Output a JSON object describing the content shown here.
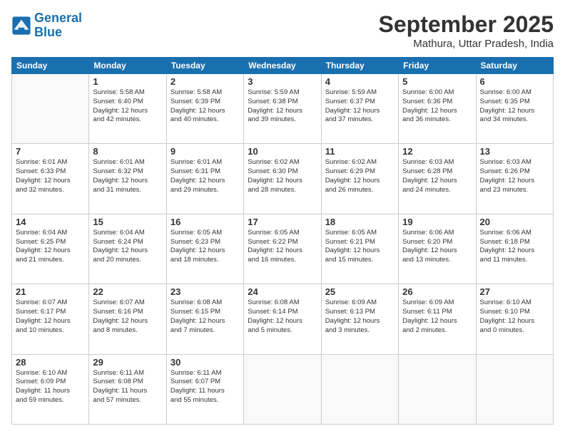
{
  "header": {
    "logo_line1": "General",
    "logo_line2": "Blue",
    "month": "September 2025",
    "location": "Mathura, Uttar Pradesh, India"
  },
  "weekdays": [
    "Sunday",
    "Monday",
    "Tuesday",
    "Wednesday",
    "Thursday",
    "Friday",
    "Saturday"
  ],
  "weeks": [
    [
      {
        "day": "",
        "info": ""
      },
      {
        "day": "1",
        "info": "Sunrise: 5:58 AM\nSunset: 6:40 PM\nDaylight: 12 hours\nand 42 minutes."
      },
      {
        "day": "2",
        "info": "Sunrise: 5:58 AM\nSunset: 6:39 PM\nDaylight: 12 hours\nand 40 minutes."
      },
      {
        "day": "3",
        "info": "Sunrise: 5:59 AM\nSunset: 6:38 PM\nDaylight: 12 hours\nand 39 minutes."
      },
      {
        "day": "4",
        "info": "Sunrise: 5:59 AM\nSunset: 6:37 PM\nDaylight: 12 hours\nand 37 minutes."
      },
      {
        "day": "5",
        "info": "Sunrise: 6:00 AM\nSunset: 6:36 PM\nDaylight: 12 hours\nand 36 minutes."
      },
      {
        "day": "6",
        "info": "Sunrise: 6:00 AM\nSunset: 6:35 PM\nDaylight: 12 hours\nand 34 minutes."
      }
    ],
    [
      {
        "day": "7",
        "info": "Sunrise: 6:01 AM\nSunset: 6:33 PM\nDaylight: 12 hours\nand 32 minutes."
      },
      {
        "day": "8",
        "info": "Sunrise: 6:01 AM\nSunset: 6:32 PM\nDaylight: 12 hours\nand 31 minutes."
      },
      {
        "day": "9",
        "info": "Sunrise: 6:01 AM\nSunset: 6:31 PM\nDaylight: 12 hours\nand 29 minutes."
      },
      {
        "day": "10",
        "info": "Sunrise: 6:02 AM\nSunset: 6:30 PM\nDaylight: 12 hours\nand 28 minutes."
      },
      {
        "day": "11",
        "info": "Sunrise: 6:02 AM\nSunset: 6:29 PM\nDaylight: 12 hours\nand 26 minutes."
      },
      {
        "day": "12",
        "info": "Sunrise: 6:03 AM\nSunset: 6:28 PM\nDaylight: 12 hours\nand 24 minutes."
      },
      {
        "day": "13",
        "info": "Sunrise: 6:03 AM\nSunset: 6:26 PM\nDaylight: 12 hours\nand 23 minutes."
      }
    ],
    [
      {
        "day": "14",
        "info": "Sunrise: 6:04 AM\nSunset: 6:25 PM\nDaylight: 12 hours\nand 21 minutes."
      },
      {
        "day": "15",
        "info": "Sunrise: 6:04 AM\nSunset: 6:24 PM\nDaylight: 12 hours\nand 20 minutes."
      },
      {
        "day": "16",
        "info": "Sunrise: 6:05 AM\nSunset: 6:23 PM\nDaylight: 12 hours\nand 18 minutes."
      },
      {
        "day": "17",
        "info": "Sunrise: 6:05 AM\nSunset: 6:22 PM\nDaylight: 12 hours\nand 16 minutes."
      },
      {
        "day": "18",
        "info": "Sunrise: 6:05 AM\nSunset: 6:21 PM\nDaylight: 12 hours\nand 15 minutes."
      },
      {
        "day": "19",
        "info": "Sunrise: 6:06 AM\nSunset: 6:20 PM\nDaylight: 12 hours\nand 13 minutes."
      },
      {
        "day": "20",
        "info": "Sunrise: 6:06 AM\nSunset: 6:18 PM\nDaylight: 12 hours\nand 11 minutes."
      }
    ],
    [
      {
        "day": "21",
        "info": "Sunrise: 6:07 AM\nSunset: 6:17 PM\nDaylight: 12 hours\nand 10 minutes."
      },
      {
        "day": "22",
        "info": "Sunrise: 6:07 AM\nSunset: 6:16 PM\nDaylight: 12 hours\nand 8 minutes."
      },
      {
        "day": "23",
        "info": "Sunrise: 6:08 AM\nSunset: 6:15 PM\nDaylight: 12 hours\nand 7 minutes."
      },
      {
        "day": "24",
        "info": "Sunrise: 6:08 AM\nSunset: 6:14 PM\nDaylight: 12 hours\nand 5 minutes."
      },
      {
        "day": "25",
        "info": "Sunrise: 6:09 AM\nSunset: 6:13 PM\nDaylight: 12 hours\nand 3 minutes."
      },
      {
        "day": "26",
        "info": "Sunrise: 6:09 AM\nSunset: 6:11 PM\nDaylight: 12 hours\nand 2 minutes."
      },
      {
        "day": "27",
        "info": "Sunrise: 6:10 AM\nSunset: 6:10 PM\nDaylight: 12 hours\nand 0 minutes."
      }
    ],
    [
      {
        "day": "28",
        "info": "Sunrise: 6:10 AM\nSunset: 6:09 PM\nDaylight: 11 hours\nand 59 minutes."
      },
      {
        "day": "29",
        "info": "Sunrise: 6:11 AM\nSunset: 6:08 PM\nDaylight: 11 hours\nand 57 minutes."
      },
      {
        "day": "30",
        "info": "Sunrise: 6:11 AM\nSunset: 6:07 PM\nDaylight: 11 hours\nand 55 minutes."
      },
      {
        "day": "",
        "info": ""
      },
      {
        "day": "",
        "info": ""
      },
      {
        "day": "",
        "info": ""
      },
      {
        "day": "",
        "info": ""
      }
    ]
  ]
}
